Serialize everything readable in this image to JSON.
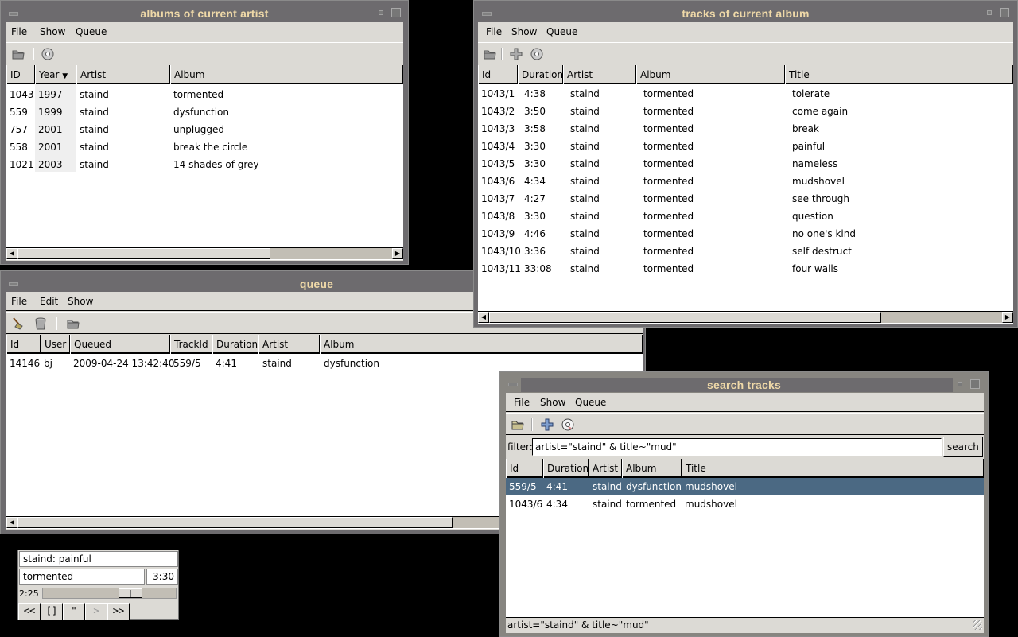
{
  "albums_window": {
    "title": "albums of current artist",
    "menu": [
      "File",
      "Show",
      "Queue"
    ],
    "toolbar": [
      "folder-open-icon",
      "cd-icon"
    ],
    "columns": [
      "ID",
      "Year",
      "Artist",
      "Album"
    ],
    "sort_column": "Year",
    "sort_icon": "sort-desc-arrow-icon",
    "rows": [
      [
        "1043",
        "1997",
        "staind",
        "tormented"
      ],
      [
        "559",
        "1999",
        "staind",
        "dysfunction"
      ],
      [
        "757",
        "2001",
        "staind",
        "unplugged"
      ],
      [
        "558",
        "2001",
        "staind",
        "break the circle"
      ],
      [
        "1021",
        "2003",
        "staind",
        "14 shades of grey"
      ]
    ]
  },
  "tracks_window": {
    "title": "tracks of current album",
    "menu": [
      "File",
      "Show",
      "Queue"
    ],
    "toolbar": [
      "folder-open-icon",
      "add-icon",
      "cd-icon"
    ],
    "columns": [
      "Id",
      "Duration",
      "Artist",
      "Album",
      "Title"
    ],
    "rows": [
      [
        "1043/1",
        "4:38",
        "staind",
        "tormented",
        "tolerate"
      ],
      [
        "1043/2",
        "3:50",
        "staind",
        "tormented",
        "come again"
      ],
      [
        "1043/3",
        "3:58",
        "staind",
        "tormented",
        "break"
      ],
      [
        "1043/4",
        "3:30",
        "staind",
        "tormented",
        "painful"
      ],
      [
        "1043/5",
        "3:30",
        "staind",
        "tormented",
        "nameless"
      ],
      [
        "1043/6",
        "4:34",
        "staind",
        "tormented",
        "mudshovel"
      ],
      [
        "1043/7",
        "4:27",
        "staind",
        "tormented",
        "see through"
      ],
      [
        "1043/8",
        "3:30",
        "staind",
        "tormented",
        "question"
      ],
      [
        "1043/9",
        "4:46",
        "staind",
        "tormented",
        "no one's kind"
      ],
      [
        "1043/10",
        "3:36",
        "staind",
        "tormented",
        "self destruct"
      ],
      [
        "1043/11",
        "33:08",
        "staind",
        "tormented",
        "four walls"
      ]
    ]
  },
  "queue_window": {
    "title": "queue",
    "menu": [
      "File",
      "Edit",
      "Show"
    ],
    "toolbar": [
      "broom-clean-icon",
      "trash-icon",
      "folder-open-icon"
    ],
    "columns": [
      "Id",
      "User",
      "Queued",
      "TrackId",
      "Duration",
      "Artist",
      "Album"
    ],
    "rows": [
      [
        "14146",
        "bj",
        "2009-04-24 13:42:40",
        "559/5",
        "4:41",
        "staind",
        "dysfunction"
      ]
    ]
  },
  "search_window": {
    "title": "search tracks",
    "menu": [
      "File",
      "Show",
      "Queue"
    ],
    "toolbar": [
      "folder-open-icon",
      "add-icon",
      "cd-icon"
    ],
    "filter_label": "filter:",
    "filter_value": "artist=\"staind\" & title~\"mud\"",
    "search_button": "search",
    "columns": [
      "Id",
      "Duration",
      "Artist",
      "Album",
      "Title"
    ],
    "rows": [
      [
        "559/5",
        "4:41",
        "staind",
        "dysfunction",
        "mudshovel"
      ],
      [
        "1043/6",
        "4:34",
        "staind",
        "tormented",
        "mudshovel"
      ]
    ],
    "selected_row": 0,
    "status": "artist=\"staind\" & title~\"mud\""
  },
  "player": {
    "now_playing": "staind: painful",
    "album": "tormented",
    "length": "3:30",
    "elapsed": "2:25",
    "progress_fraction": 0.69,
    "buttons": [
      "<<",
      "[]",
      "\"",
      ">",
      ">>"
    ],
    "disabled_buttons": [
      ">"
    ]
  },
  "colors": {
    "title_text": "#efd9a8",
    "selection": "#4b6983",
    "window_frame": "#6d6b6e",
    "panel": "#dcdad5"
  }
}
